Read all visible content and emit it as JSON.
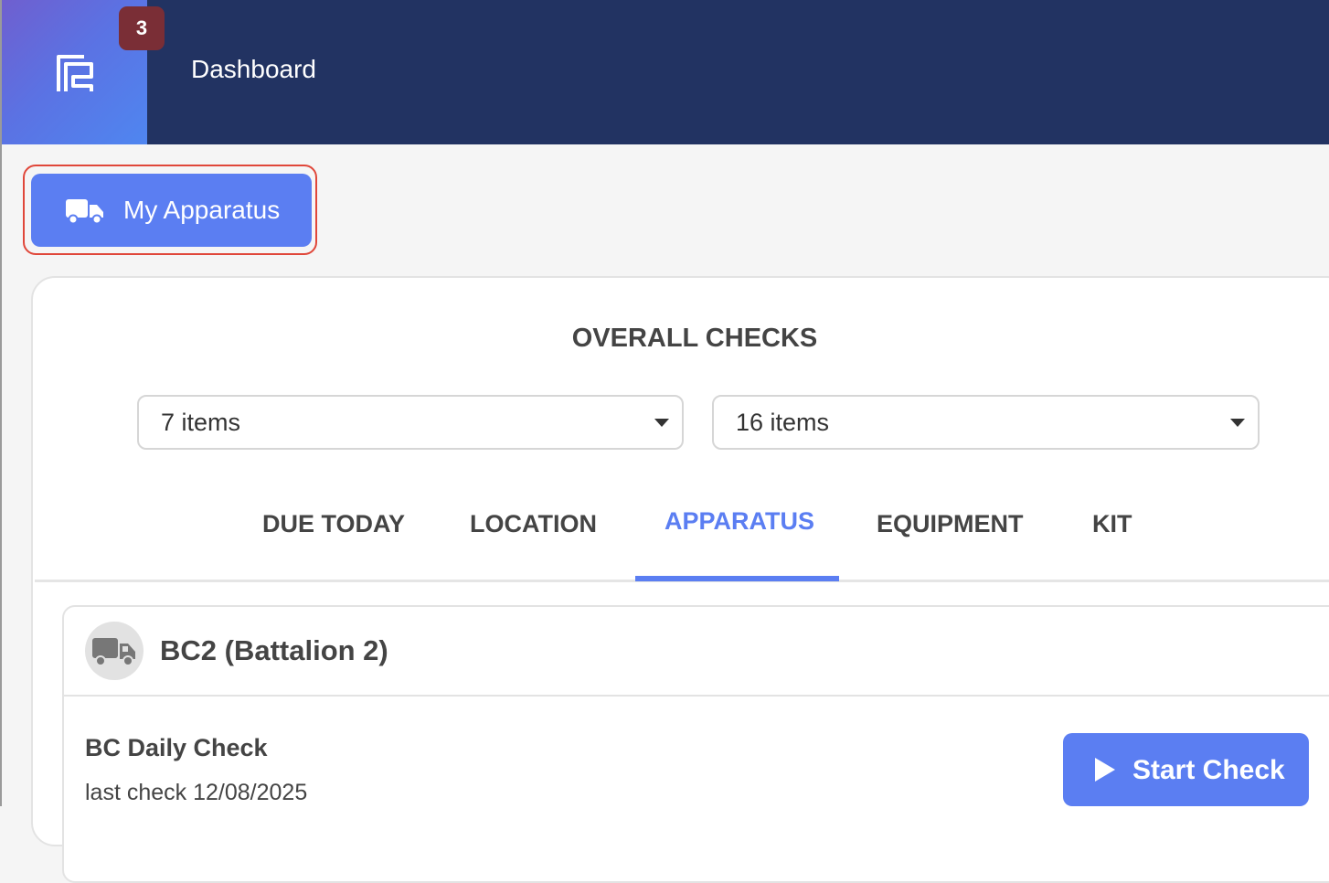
{
  "header": {
    "title": "Dashboard",
    "badge_count": "3",
    "logo_icon": "app-logo-icon"
  },
  "apparatus_button": {
    "label": "My Apparatus",
    "icon": "truck-icon"
  },
  "overall_checks": {
    "title": "OVERALL CHECKS",
    "selects": [
      {
        "value": "7 items"
      },
      {
        "value": "16 items"
      }
    ]
  },
  "tabs": [
    {
      "label": "DUE TODAY",
      "active": false
    },
    {
      "label": "LOCATION",
      "active": false
    },
    {
      "label": "APPARATUS",
      "active": true
    },
    {
      "label": "EQUIPMENT",
      "active": false
    },
    {
      "label": "KIT",
      "active": false
    }
  ],
  "apparatus_item": {
    "title": "BC2 (Battalion 2)",
    "icon": "truck-icon",
    "check": {
      "name": "BC Daily Check",
      "last_check": "last check 12/08/2025",
      "start_label": "Start Check"
    }
  },
  "colors": {
    "header_bg": "#223362",
    "accent": "#5b7ef2",
    "badge_bg": "#7a2e36",
    "focus_ring": "#e0473a"
  }
}
